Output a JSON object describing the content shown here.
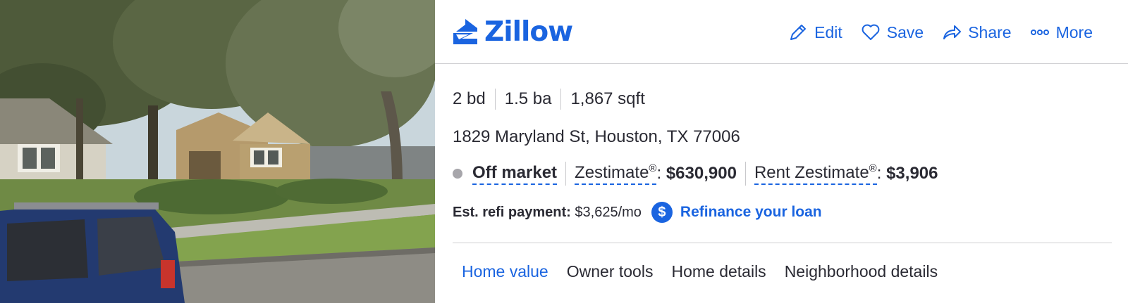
{
  "photo": {
    "alt_subject": "street-view-house"
  },
  "header": {
    "logo_text": "Zillow",
    "actions": [
      {
        "label": "Edit",
        "icon": "pencil-icon"
      },
      {
        "label": "Save",
        "icon": "heart-icon"
      },
      {
        "label": "Share",
        "icon": "share-arrow-icon"
      },
      {
        "label": "More",
        "icon": "ellipsis-icon"
      }
    ]
  },
  "facts": [
    "2 bd",
    "1.5 ba",
    "1,867 sqft"
  ],
  "address": "1829 Maryland St, Houston, TX 77006",
  "status": {
    "label": "Off market",
    "zestimate_label": "Zestimate",
    "zestimate_value": "$630,900",
    "rent_label": "Rent Zestimate",
    "rent_value": "$3,906",
    "registered_mark": "®"
  },
  "refi": {
    "label": "Est. refi payment:",
    "value": "$3,625/mo",
    "icon_symbol": "$",
    "link": "Refinance your loan"
  },
  "tabs": [
    "Home value",
    "Owner tools",
    "Home details",
    "Neighborhood details"
  ],
  "colors": {
    "brand": "#1a64e0",
    "text": "#2a2a33",
    "status_dot": "#a7a6ab"
  }
}
